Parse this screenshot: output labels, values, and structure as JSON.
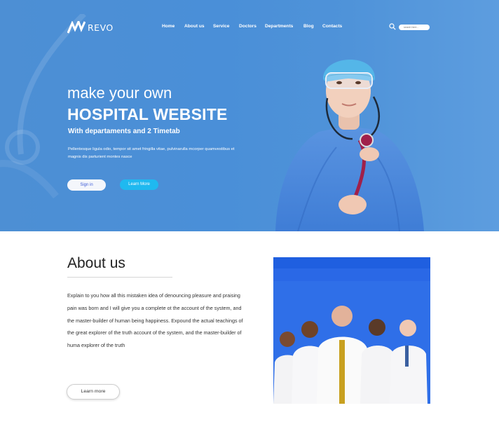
{
  "nav": {
    "logo_text": "REVO",
    "items": [
      "Home",
      "About us",
      "Service",
      "Doctors",
      "Departments",
      "Blog",
      "Contacts"
    ],
    "search_placeholder": "search here..."
  },
  "hero": {
    "line1": "make your own",
    "line2": "HOSPITAL WEBSITE",
    "line3": "With departaments and 2 Timetab",
    "description": "Pellentesque ligula odio, tempor sit amet fringilla vitae, pulvinarulla mcorper quamvestibus et magnis dis parturient montes nasce",
    "signin_label": "Sign in",
    "learn_label": "Learn More"
  },
  "about": {
    "title": "About us",
    "text": "Explain to you how all this mistaken idea of denouncing pleasure and praising pain was born and I will give you a complete ot the account of the system, and the master-builder of human being happiness. Expound the actual teachings of the great explorer of the truth account of the system, and the master-builder of huma explorer of the truth",
    "button_label": "Learn more"
  },
  "colors": {
    "hero_blue": "#4d8fd4",
    "accent_cyan": "#1fb9f0",
    "photo_blue": "#2f6fe8"
  },
  "icons": [
    "logo-mark-icon",
    "search-icon"
  ]
}
